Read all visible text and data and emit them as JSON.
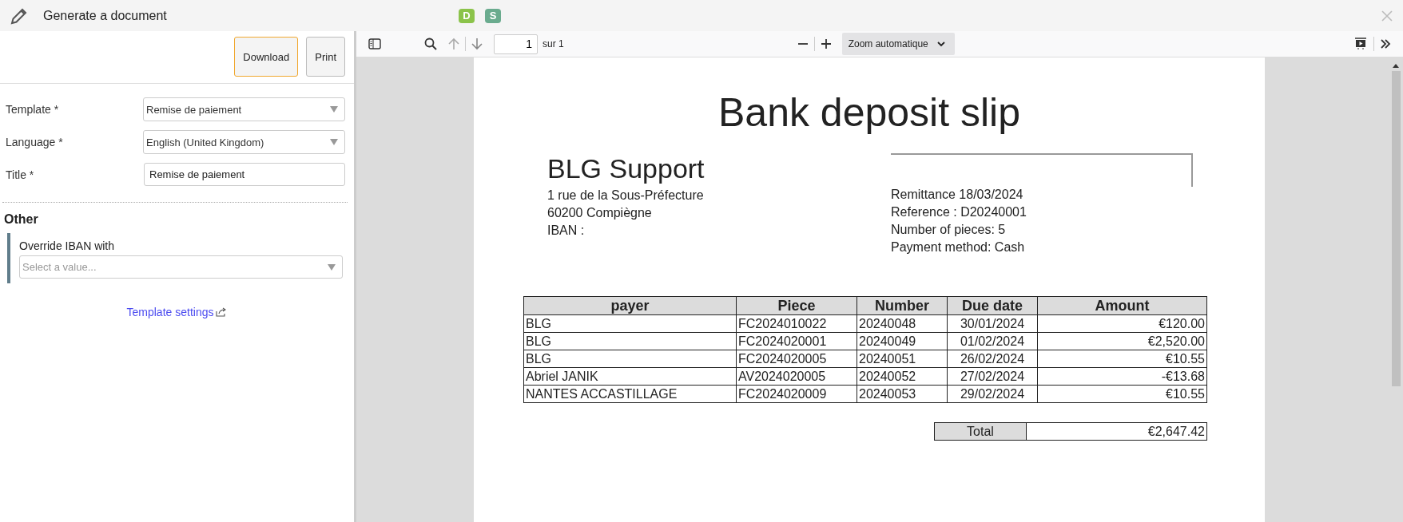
{
  "window": {
    "title": "Generate a document",
    "badges": [
      {
        "label": "D",
        "color": "#8bc34a"
      },
      {
        "label": "S",
        "color": "#6aab8e"
      }
    ]
  },
  "actions": [
    "Download",
    "Print"
  ],
  "form": {
    "fields": [
      {
        "label": "Template *",
        "kind": "select",
        "value": "Remise de paiement"
      },
      {
        "label": "Language *",
        "kind": "select",
        "value": "English (United Kingdom)"
      },
      {
        "label": "Title *",
        "kind": "text",
        "value": "Remise de paiement"
      }
    ]
  },
  "other": {
    "heading": "Other",
    "label": "Override IBAN with",
    "placeholder": "Select a value..."
  },
  "settings_link": "Template settings",
  "viewer": {
    "page": "1",
    "page_total": "sur 1",
    "zoom": "Zoom automatique"
  },
  "document": {
    "title": "Bank deposit slip",
    "company": "BLG Support",
    "address": [
      "1 rue de la Sous-Préfecture",
      "60200 Compiègne",
      "IBAN :"
    ],
    "info": [
      "Remittance 18/03/2024",
      "Reference : D20240001",
      "Number of pieces: 5",
      "Payment method: Cash"
    ],
    "columns": [
      "payer",
      "Piece",
      "Number",
      "Due date",
      "Amount"
    ],
    "rows": [
      [
        "BLG",
        "FC2024010022",
        "20240048",
        "30/01/2024",
        "€120.00"
      ],
      [
        "BLG",
        "FC2024020001",
        "20240049",
        "01/02/2024",
        "€2,520.00"
      ],
      [
        "BLG",
        "FC2024020005",
        "20240051",
        "26/02/2024",
        "€10.55"
      ],
      [
        "Abriel JANIK",
        "AV2024020005",
        "20240052",
        "27/02/2024",
        "-€13.68"
      ],
      [
        "NANTES ACCASTILLAGE",
        "FC2024020009",
        "20240053",
        "29/02/2024",
        "€10.55"
      ]
    ],
    "total_label": "Total",
    "total_value": "€2,647.42"
  }
}
